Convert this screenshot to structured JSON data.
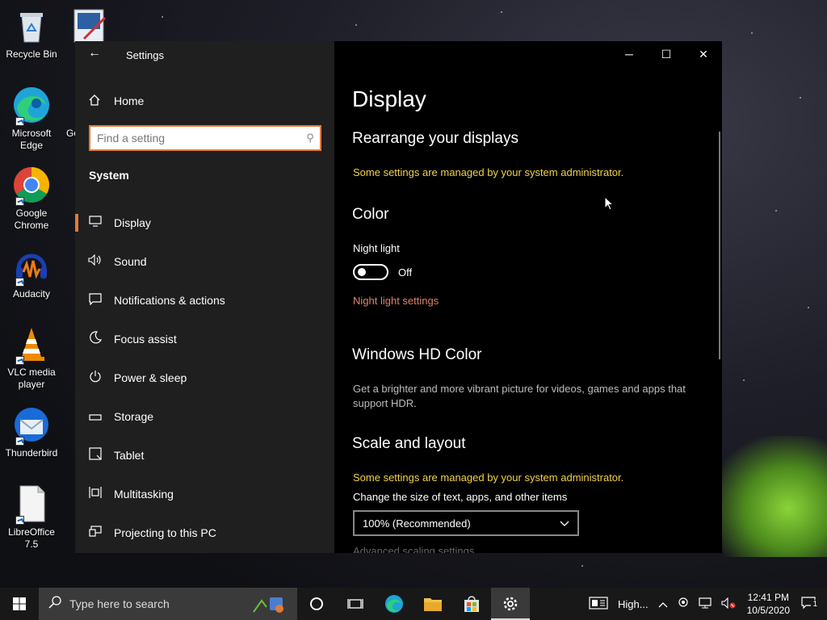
{
  "desktop": {
    "icons": [
      {
        "label": "Recycle Bin"
      },
      {
        "label": "Microsoft Edge"
      },
      {
        "label": "Google Chrome"
      },
      {
        "label": "Audacity"
      },
      {
        "label": "VLC media player"
      },
      {
        "label": "Thunderbird"
      },
      {
        "label": "LibreOffice 7.5"
      }
    ],
    "partial_label": "Go"
  },
  "window": {
    "title": "Settings",
    "controls": {
      "minimize": "─",
      "maximize": "☐",
      "close": "✕"
    }
  },
  "sidebar": {
    "home_label": "Home",
    "search_placeholder": "Find a setting",
    "section_title": "System",
    "items": [
      {
        "label": "Display",
        "icon": "monitor-icon",
        "active": true
      },
      {
        "label": "Sound",
        "icon": "speaker-icon"
      },
      {
        "label": "Notifications & actions",
        "icon": "message-icon"
      },
      {
        "label": "Focus assist",
        "icon": "moon-icon"
      },
      {
        "label": "Power & sleep",
        "icon": "power-icon"
      },
      {
        "label": "Storage",
        "icon": "storage-icon"
      },
      {
        "label": "Tablet",
        "icon": "tablet-icon"
      },
      {
        "label": "Multitasking",
        "icon": "multitasking-icon"
      },
      {
        "label": "Projecting to this PC",
        "icon": "projector-icon"
      }
    ]
  },
  "content": {
    "page_title": "Display",
    "rearrange": {
      "heading": "Rearrange your displays",
      "admin_notice": "Some settings are managed by your system administrator."
    },
    "color": {
      "heading": "Color",
      "night_light_label": "Night light",
      "night_light_state": "Off",
      "night_light_link": "Night light settings"
    },
    "hd_color": {
      "heading": "Windows HD Color",
      "description": "Get a brighter and more vibrant picture for videos, games and apps that support HDR."
    },
    "scale": {
      "heading": "Scale and layout",
      "admin_notice": "Some settings are managed by your system administrator.",
      "size_label": "Change the size of text, apps, and other items",
      "size_value": "100% (Recommended)",
      "cut_off_text": "Advanced scaling settings"
    }
  },
  "taskbar": {
    "search_placeholder": "Type here to search",
    "tray_label": "High...",
    "time": "12:41 PM",
    "date": "10/5/2020",
    "notification_count": "1"
  },
  "colors": {
    "accent": "#e07b39",
    "warning": "#f2d14a",
    "link": "#e0826a",
    "sidebar_bg": "#1f1f1f",
    "content_bg": "#000000",
    "taskbar_bg": "#181818"
  }
}
